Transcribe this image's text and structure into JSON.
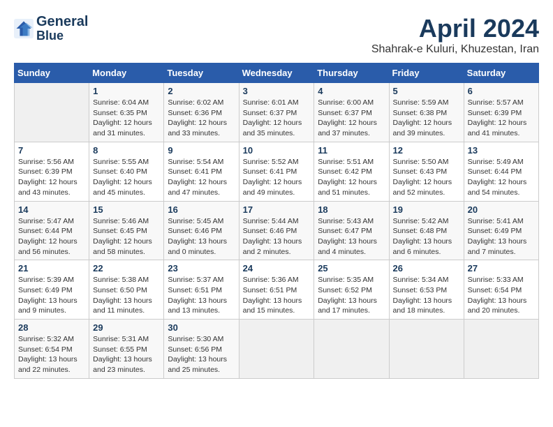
{
  "logo": {
    "line1": "General",
    "line2": "Blue"
  },
  "title": "April 2024",
  "subtitle": "Shahrak-e Kuluri, Khuzestan, Iran",
  "weekdays": [
    "Sunday",
    "Monday",
    "Tuesday",
    "Wednesday",
    "Thursday",
    "Friday",
    "Saturday"
  ],
  "weeks": [
    [
      {
        "day": "",
        "info": ""
      },
      {
        "day": "1",
        "info": "Sunrise: 6:04 AM\nSunset: 6:35 PM\nDaylight: 12 hours\nand 31 minutes."
      },
      {
        "day": "2",
        "info": "Sunrise: 6:02 AM\nSunset: 6:36 PM\nDaylight: 12 hours\nand 33 minutes."
      },
      {
        "day": "3",
        "info": "Sunrise: 6:01 AM\nSunset: 6:37 PM\nDaylight: 12 hours\nand 35 minutes."
      },
      {
        "day": "4",
        "info": "Sunrise: 6:00 AM\nSunset: 6:37 PM\nDaylight: 12 hours\nand 37 minutes."
      },
      {
        "day": "5",
        "info": "Sunrise: 5:59 AM\nSunset: 6:38 PM\nDaylight: 12 hours\nand 39 minutes."
      },
      {
        "day": "6",
        "info": "Sunrise: 5:57 AM\nSunset: 6:39 PM\nDaylight: 12 hours\nand 41 minutes."
      }
    ],
    [
      {
        "day": "7",
        "info": "Sunrise: 5:56 AM\nSunset: 6:39 PM\nDaylight: 12 hours\nand 43 minutes."
      },
      {
        "day": "8",
        "info": "Sunrise: 5:55 AM\nSunset: 6:40 PM\nDaylight: 12 hours\nand 45 minutes."
      },
      {
        "day": "9",
        "info": "Sunrise: 5:54 AM\nSunset: 6:41 PM\nDaylight: 12 hours\nand 47 minutes."
      },
      {
        "day": "10",
        "info": "Sunrise: 5:52 AM\nSunset: 6:41 PM\nDaylight: 12 hours\nand 49 minutes."
      },
      {
        "day": "11",
        "info": "Sunrise: 5:51 AM\nSunset: 6:42 PM\nDaylight: 12 hours\nand 51 minutes."
      },
      {
        "day": "12",
        "info": "Sunrise: 5:50 AM\nSunset: 6:43 PM\nDaylight: 12 hours\nand 52 minutes."
      },
      {
        "day": "13",
        "info": "Sunrise: 5:49 AM\nSunset: 6:44 PM\nDaylight: 12 hours\nand 54 minutes."
      }
    ],
    [
      {
        "day": "14",
        "info": "Sunrise: 5:47 AM\nSunset: 6:44 PM\nDaylight: 12 hours\nand 56 minutes."
      },
      {
        "day": "15",
        "info": "Sunrise: 5:46 AM\nSunset: 6:45 PM\nDaylight: 12 hours\nand 58 minutes."
      },
      {
        "day": "16",
        "info": "Sunrise: 5:45 AM\nSunset: 6:46 PM\nDaylight: 13 hours\nand 0 minutes."
      },
      {
        "day": "17",
        "info": "Sunrise: 5:44 AM\nSunset: 6:46 PM\nDaylight: 13 hours\nand 2 minutes."
      },
      {
        "day": "18",
        "info": "Sunrise: 5:43 AM\nSunset: 6:47 PM\nDaylight: 13 hours\nand 4 minutes."
      },
      {
        "day": "19",
        "info": "Sunrise: 5:42 AM\nSunset: 6:48 PM\nDaylight: 13 hours\nand 6 minutes."
      },
      {
        "day": "20",
        "info": "Sunrise: 5:41 AM\nSunset: 6:49 PM\nDaylight: 13 hours\nand 7 minutes."
      }
    ],
    [
      {
        "day": "21",
        "info": "Sunrise: 5:39 AM\nSunset: 6:49 PM\nDaylight: 13 hours\nand 9 minutes."
      },
      {
        "day": "22",
        "info": "Sunrise: 5:38 AM\nSunset: 6:50 PM\nDaylight: 13 hours\nand 11 minutes."
      },
      {
        "day": "23",
        "info": "Sunrise: 5:37 AM\nSunset: 6:51 PM\nDaylight: 13 hours\nand 13 minutes."
      },
      {
        "day": "24",
        "info": "Sunrise: 5:36 AM\nSunset: 6:51 PM\nDaylight: 13 hours\nand 15 minutes."
      },
      {
        "day": "25",
        "info": "Sunrise: 5:35 AM\nSunset: 6:52 PM\nDaylight: 13 hours\nand 17 minutes."
      },
      {
        "day": "26",
        "info": "Sunrise: 5:34 AM\nSunset: 6:53 PM\nDaylight: 13 hours\nand 18 minutes."
      },
      {
        "day": "27",
        "info": "Sunrise: 5:33 AM\nSunset: 6:54 PM\nDaylight: 13 hours\nand 20 minutes."
      }
    ],
    [
      {
        "day": "28",
        "info": "Sunrise: 5:32 AM\nSunset: 6:54 PM\nDaylight: 13 hours\nand 22 minutes."
      },
      {
        "day": "29",
        "info": "Sunrise: 5:31 AM\nSunset: 6:55 PM\nDaylight: 13 hours\nand 23 minutes."
      },
      {
        "day": "30",
        "info": "Sunrise: 5:30 AM\nSunset: 6:56 PM\nDaylight: 13 hours\nand 25 minutes."
      },
      {
        "day": "",
        "info": ""
      },
      {
        "day": "",
        "info": ""
      },
      {
        "day": "",
        "info": ""
      },
      {
        "day": "",
        "info": ""
      }
    ]
  ]
}
